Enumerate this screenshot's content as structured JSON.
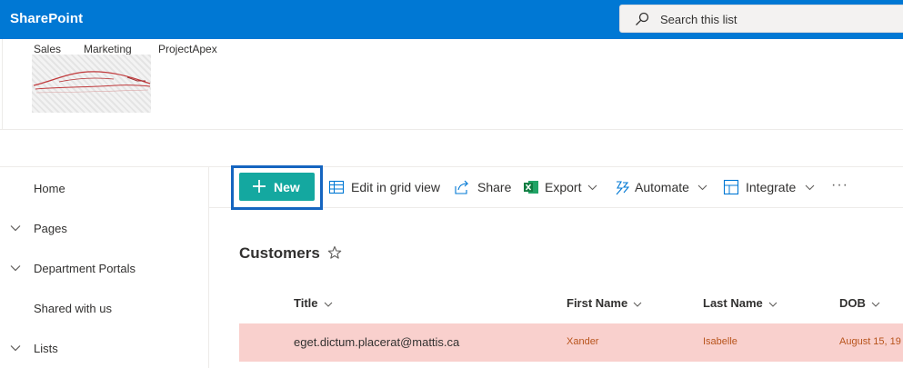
{
  "suite": {
    "brand": "SharePoint"
  },
  "search": {
    "placeholder": "Search this list",
    "icon": "search-icon"
  },
  "hub_nav": [
    "Sales",
    "Marketing",
    "ProjectApex"
  ],
  "site_logo": {
    "icon": "car-logo"
  },
  "left_nav": [
    {
      "label": "Home",
      "expandable": false
    },
    {
      "label": "Pages",
      "expandable": true
    },
    {
      "label": "Department Portals",
      "expandable": true
    },
    {
      "label": "Shared with us",
      "expandable": false
    },
    {
      "label": "Lists",
      "expandable": true
    }
  ],
  "command_bar": {
    "new_label": "New",
    "edit_grid_label": "Edit in grid view",
    "share_label": "Share",
    "export_label": "Export",
    "automate_label": "Automate",
    "integrate_label": "Integrate",
    "more_label": "···"
  },
  "list": {
    "title": "Customers",
    "columns": [
      "Title",
      "First Name",
      "Last Name",
      "DOB"
    ],
    "rows": [
      {
        "title": "eget.dictum.placerat@mattis.ca",
        "first_name": "Xander",
        "last_name": "Isabelle",
        "dob": "August 15, 19"
      }
    ]
  },
  "colors": {
    "suite_bar": "#0078d4",
    "new_button": "#14a8a0",
    "highlight_border": "#1565c0",
    "row_highlight": "#f9d0cd",
    "row_text": "#b8541c"
  }
}
